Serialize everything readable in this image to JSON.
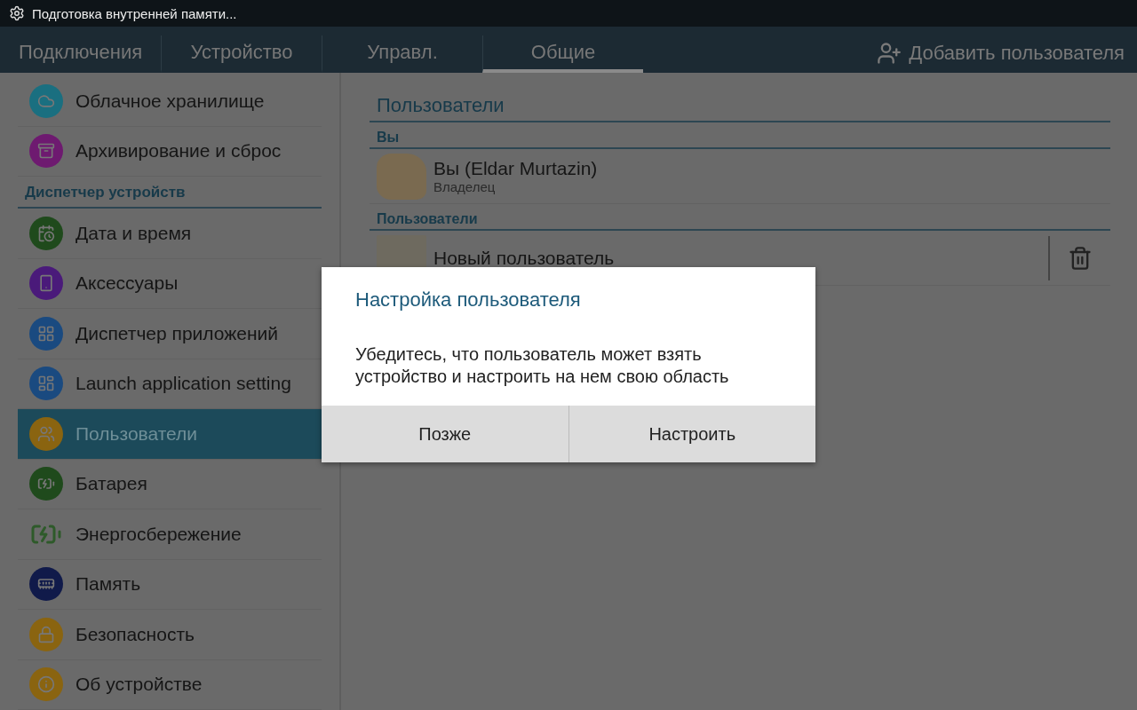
{
  "status_bar": {
    "notification": "Подготовка внутренней памяти..."
  },
  "tabs": [
    {
      "label": "Подключения",
      "selected": false
    },
    {
      "label": "Устройство",
      "selected": false
    },
    {
      "label": "Управл.",
      "selected": false
    },
    {
      "label": "Общие",
      "selected": true
    }
  ],
  "add_user": {
    "label": "Добавить пользователя"
  },
  "sidebar": {
    "items": [
      {
        "kind": "item",
        "label": "Облачное хранилище",
        "color": "#1a6f80",
        "selected": false
      },
      {
        "kind": "item",
        "label": "Архивирование и сброс",
        "color": "#6e1a70",
        "selected": false
      },
      {
        "kind": "header",
        "label": "Диспетчер устройств"
      },
      {
        "kind": "item",
        "label": "Дата и время",
        "color": "#1f4a1c",
        "selected": false
      },
      {
        "kind": "item",
        "label": "Аксессуары",
        "color": "#4a1a7a",
        "selected": false
      },
      {
        "kind": "item",
        "label": "Диспетчер приложений",
        "color": "#1a4a80",
        "selected": false
      },
      {
        "kind": "item",
        "label": "Launch application setting",
        "color": "#1a4a80",
        "selected": false
      },
      {
        "kind": "item",
        "label": "Пользователи",
        "color": "#8a6410",
        "selected": true
      },
      {
        "kind": "item",
        "label": "Батарея",
        "color": "#1f4a1c",
        "selected": false
      },
      {
        "kind": "battery",
        "label": "Энергосбережение",
        "selected": false
      },
      {
        "kind": "item",
        "label": "Память",
        "color": "#101a4a",
        "selected": false
      },
      {
        "kind": "item",
        "label": "Безопасность",
        "color": "#8a6410",
        "selected": false
      },
      {
        "kind": "item",
        "label": "Об устройстве",
        "color": "#8a6410",
        "selected": false
      }
    ]
  },
  "content": {
    "title": "Пользователи",
    "sections": [
      {
        "header": "Вы",
        "users": [
          {
            "name": "Вы (Eldar Murtazin)",
            "role": "Владелец",
            "deletable": false
          }
        ]
      },
      {
        "header": "Пользователи",
        "users": [
          {
            "name": "Новый пользователь",
            "deletable": true
          }
        ]
      }
    ]
  },
  "dialog": {
    "title": "Настройка пользователя",
    "message": "Убедитесь, что пользователь может взять устройство и настроить на нем свою область",
    "buttons": [
      "Позже",
      "Настроить"
    ]
  }
}
